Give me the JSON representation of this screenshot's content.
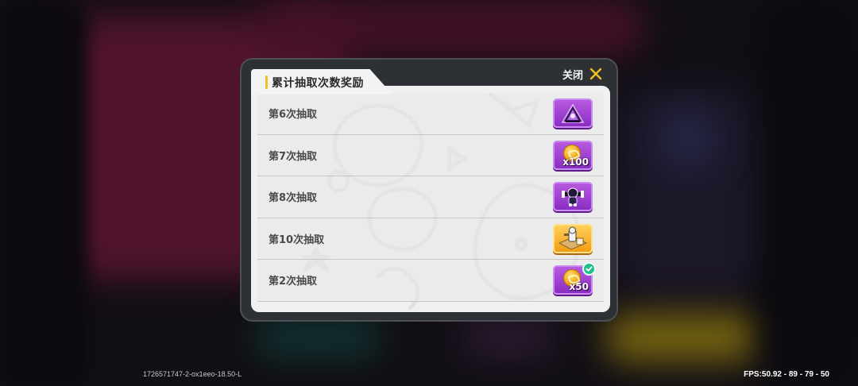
{
  "dialog": {
    "title": "累计抽取次数奖励",
    "close_label": "关闭"
  },
  "rewards": [
    {
      "label": "第6次抽取",
      "item": "purple-figure-icon",
      "qty": "",
      "claimed": false
    },
    {
      "label": "第7次抽取",
      "item": "gold-coin-icon",
      "qty": "x100",
      "claimed": false
    },
    {
      "label": "第8次抽取",
      "item": "dark-creature-icon",
      "qty": "",
      "claimed": false
    },
    {
      "label": "第10次抽取",
      "item": "map-scroll-icon",
      "qty": "",
      "claimed": false
    },
    {
      "label": "第2次抽取",
      "item": "gold-coin-icon",
      "qty": "x50",
      "claimed": true
    }
  ],
  "footer": {
    "build_id": "1726571747-2-ox1eeo-18.50-L",
    "fps": "FPS:50.92 - 89 - 79 - 50"
  },
  "colors": {
    "accent": "#f2c21c",
    "rare_purple": "#a047d6",
    "gold": "#f5b22a",
    "claimed_green": "#1fbf8e"
  }
}
